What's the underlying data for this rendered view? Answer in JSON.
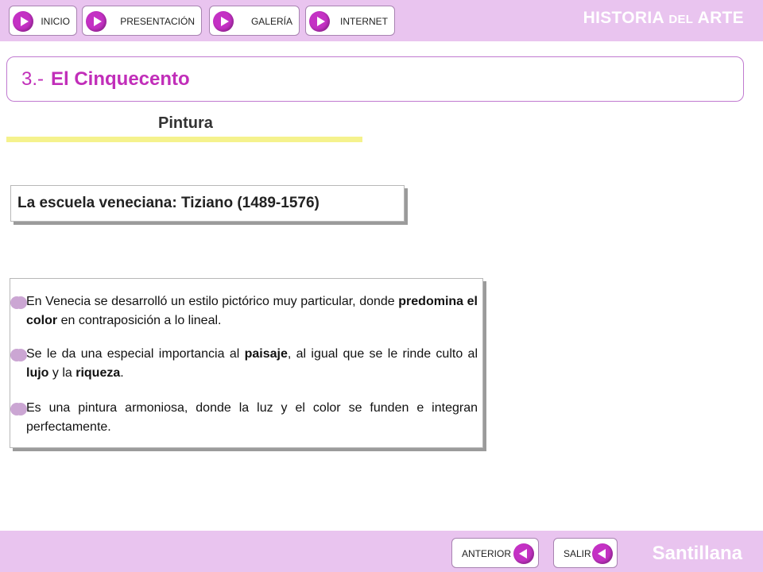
{
  "header": {
    "nav": [
      {
        "label": "INICIO"
      },
      {
        "label": "PRESENTACIÓN"
      },
      {
        "label": "GALERÍA"
      },
      {
        "label": "INTERNET"
      }
    ],
    "brand": {
      "part1": "HISTORIA ",
      "part2": "DEL",
      "part3": " ARTE"
    }
  },
  "section": {
    "number": "3.-",
    "title": "El Cinquecento"
  },
  "subtitle": "Pintura",
  "escuela": "La escuela veneciana: Tiziano (1489-1576)",
  "bullets": [
    {
      "segments": [
        {
          "text": "En Venecia se desarrolló un estilo pictórico muy particular, donde "
        },
        {
          "text": "predomina el color",
          "bold": true
        },
        {
          "text": " en contraposición a lo lineal."
        }
      ]
    },
    {
      "segments": [
        {
          "text": "Se le da una especial importancia al "
        },
        {
          "text": "paisaje",
          "bold": true
        },
        {
          "text": ", al igual que se le rinde culto al "
        },
        {
          "text": "lujo",
          "bold": true
        },
        {
          "text": " y la "
        },
        {
          "text": "riqueza",
          "bold": true
        },
        {
          "text": "."
        }
      ]
    },
    {
      "segments": [
        {
          "text": "Es una pintura armoniosa, donde la luz y el color se funden e integran perfectamente."
        }
      ]
    }
  ],
  "footer": {
    "anterior": "ANTERIOR",
    "salir": "SALIR",
    "brand": "Santillana"
  },
  "colors": {
    "bar": "#e9c4ef",
    "accent": "#c431c4",
    "title": "#c12eb9",
    "underline": "#f5f28d"
  }
}
